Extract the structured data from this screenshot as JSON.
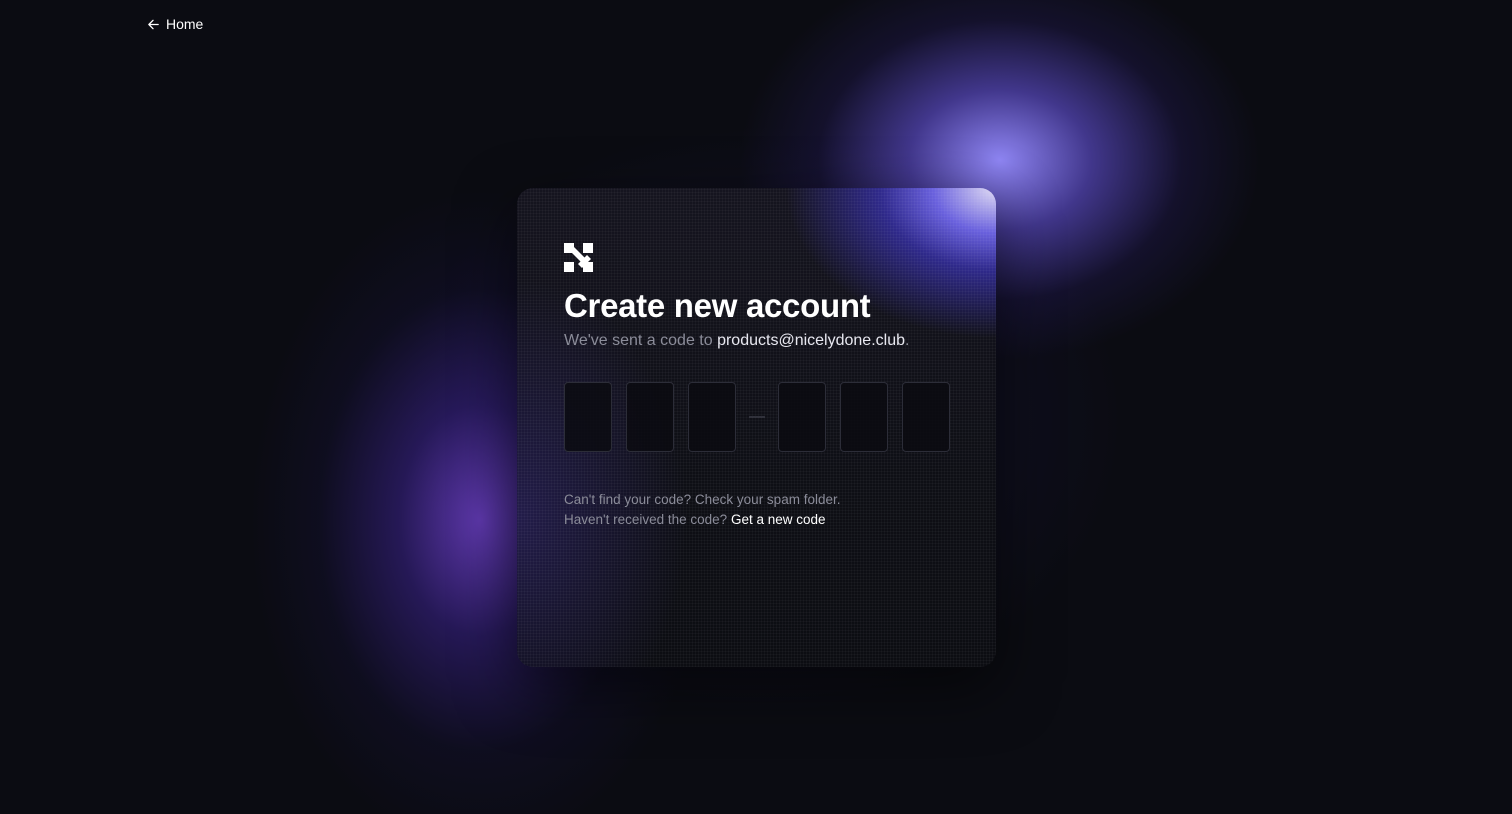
{
  "nav": {
    "back_label": "Home",
    "back_icon": "arrow-left-icon"
  },
  "card": {
    "logo_icon": "brand-logo-icon",
    "title": "Create new account",
    "subtitle_prefix": "We've sent a code to ",
    "email": "products@nicelydone.club",
    "subtitle_suffix": ".",
    "code_separator": "—",
    "code_digits": [
      "",
      "",
      "",
      "",
      "",
      ""
    ],
    "help_line_1": "Can't find your code? Check your spam folder.",
    "help_line_2_prefix": "Haven't received the code? ",
    "help_line_2_link": "Get a new code"
  },
  "colors": {
    "background": "#0b0c12",
    "accent": "#6b63ff",
    "text_primary": "#ffffff",
    "text_secondary": "#8b8c99"
  }
}
